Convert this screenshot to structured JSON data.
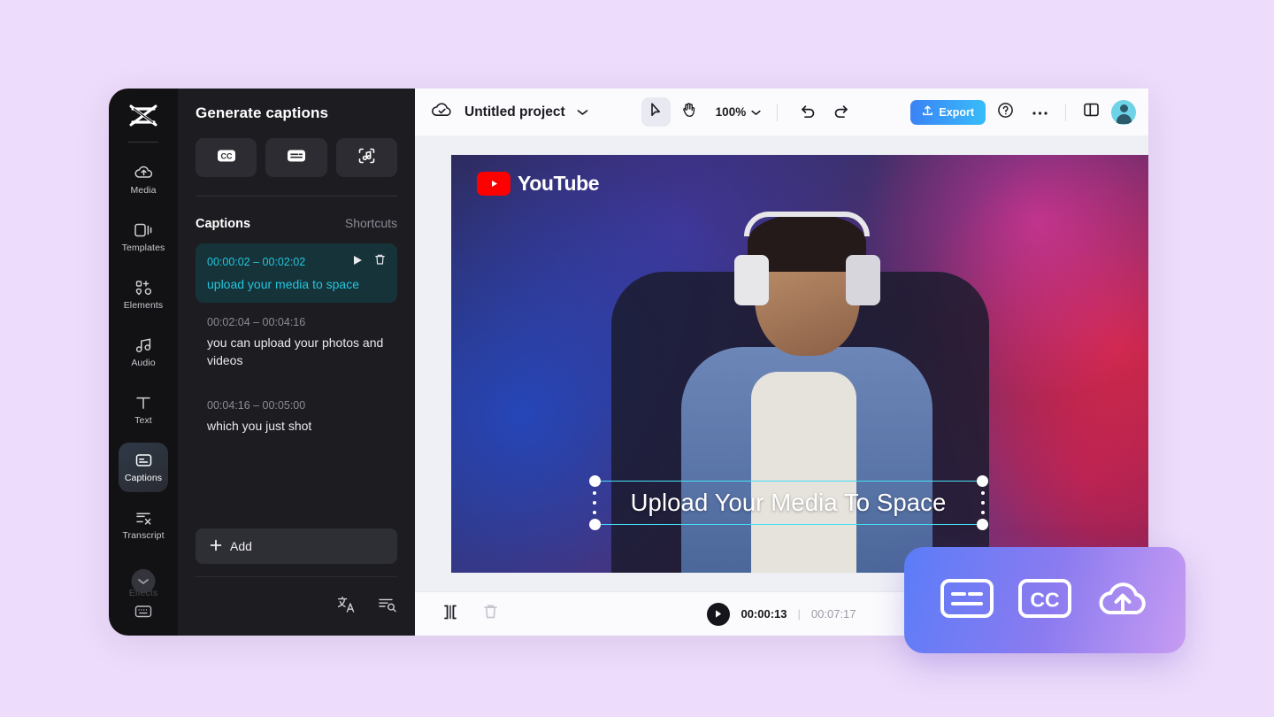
{
  "app": {
    "brand_icon": "capcut-logo-icon"
  },
  "rail": {
    "items": [
      {
        "label": "Media",
        "icon": "cloud-media-icon",
        "state": "normal"
      },
      {
        "label": "Templates",
        "icon": "templates-icon",
        "state": "normal"
      },
      {
        "label": "Elements",
        "icon": "elements-icon",
        "state": "normal"
      },
      {
        "label": "Audio",
        "icon": "audio-note-icon",
        "state": "normal"
      },
      {
        "label": "Text",
        "icon": "text-icon",
        "state": "normal"
      },
      {
        "label": "Captions",
        "icon": "captions-icon",
        "state": "active"
      },
      {
        "label": "Transcript",
        "icon": "transcript-icon",
        "state": "normal"
      },
      {
        "label": "Effects",
        "icon": "effects-star-icon",
        "state": "dim"
      }
    ],
    "expand_icon": "chevron-down-icon",
    "keyboard_icon": "keyboard-icon"
  },
  "panel": {
    "title": "Generate captions",
    "style_buttons": [
      {
        "name": "cc-style-button",
        "icon": "cc-icon"
      },
      {
        "name": "subtitle-style-button",
        "icon": "subtitle-lines-icon"
      },
      {
        "name": "auto-sound-button",
        "icon": "sound-scan-icon"
      }
    ],
    "captions_header": {
      "title": "Captions",
      "shortcuts": "Shortcuts"
    },
    "captions": [
      {
        "time": "00:00:02 – 00:02:02",
        "text": "upload your media to space",
        "selected": true,
        "play_icon": "play-icon",
        "delete_icon": "trash-icon"
      },
      {
        "time": "00:02:04 – 00:04:16",
        "text": "you can upload your photos and videos",
        "selected": false
      },
      {
        "time": "00:04:16 – 00:05:00",
        "text": "which you just shot",
        "selected": false
      }
    ],
    "add_label": "Add",
    "footer_icons": [
      {
        "name": "translate-icon"
      },
      {
        "name": "search-list-icon"
      }
    ]
  },
  "topbar": {
    "cloud_status_icon": "cloud-saved-icon",
    "project_name": "Untitled project",
    "project_chevron_icon": "chevron-down-icon",
    "tools": [
      {
        "name": "select-tool",
        "icon": "cursor-arrow-icon",
        "active": true
      },
      {
        "name": "hand-tool",
        "icon": "hand-icon",
        "active": false
      }
    ],
    "zoom_level": "100%",
    "zoom_chevron_icon": "chevron-down-icon",
    "undo_icon": "undo-icon",
    "redo_icon": "redo-icon",
    "export_label": "Export",
    "export_icon": "export-upload-icon",
    "help_icon": "help-circle-icon",
    "more_icon": "more-horizontal-icon",
    "layout_icon": "split-panel-icon",
    "avatar_icon": "user-avatar"
  },
  "canvas": {
    "watermark": "YouTube",
    "watermark_icon": "youtube-play-icon",
    "overlay_caption": "Upload Your Media To Space",
    "selection_color": "#45e0f5"
  },
  "playbar": {
    "split_icon": "split-clip-icon",
    "delete_icon": "trash-icon",
    "play_icon": "play-icon",
    "current_time": "00:00:13",
    "separator": "|",
    "total_time": "00:07:17",
    "mic_icon": "microphone-icon"
  },
  "feature_card": {
    "icons": [
      {
        "name": "subtitle-lines-icon"
      },
      {
        "name": "cc-icon"
      },
      {
        "name": "cloud-upload-icon"
      }
    ],
    "gradient_from": "#5b7cf8",
    "gradient_to": "#c79cf2"
  }
}
